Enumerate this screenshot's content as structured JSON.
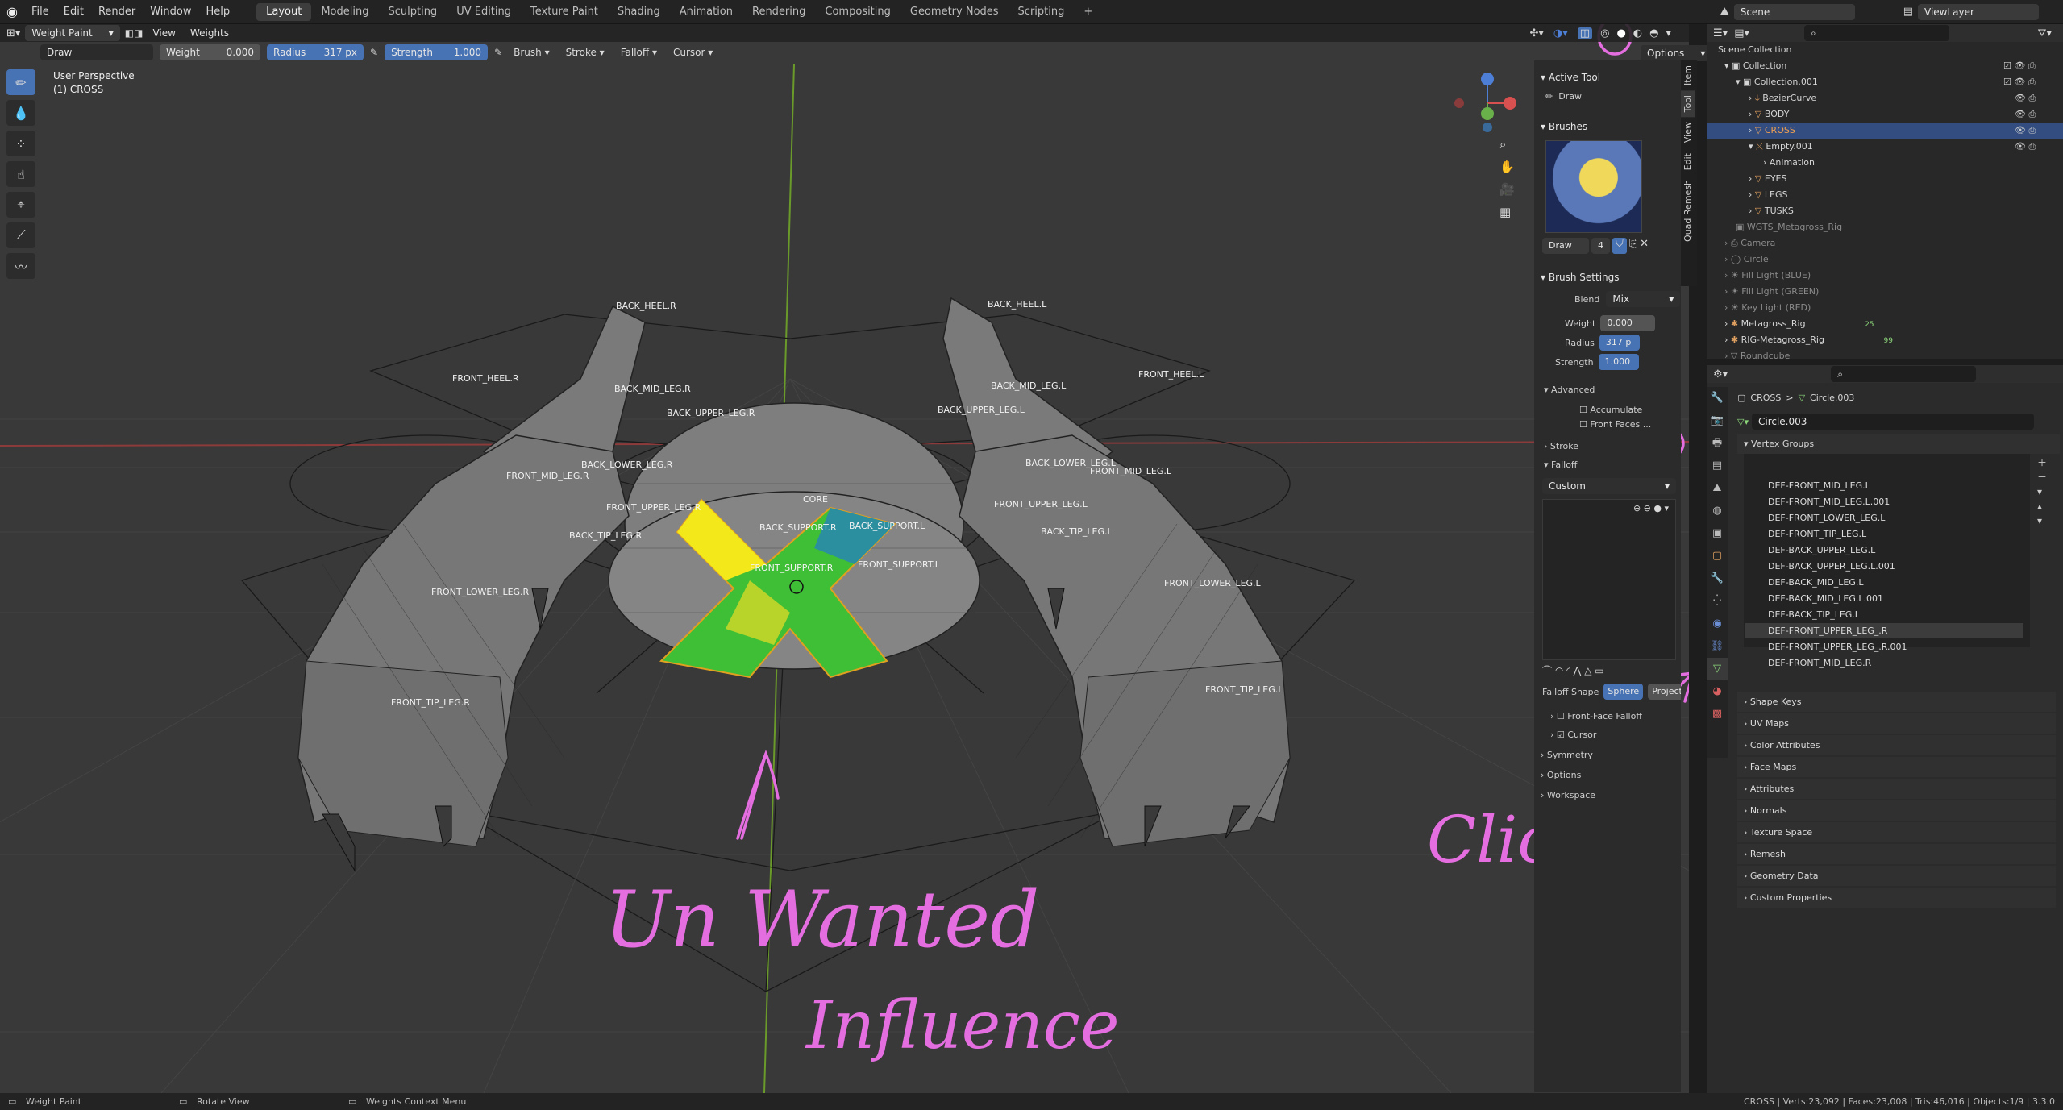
{
  "menubar": {
    "menus": [
      "File",
      "Edit",
      "Render",
      "Window",
      "Help"
    ],
    "workspaces": [
      "Layout",
      "Modeling",
      "Sculpting",
      "UV Editing",
      "Texture Paint",
      "Shading",
      "Animation",
      "Rendering",
      "Compositing",
      "Geometry Nodes",
      "Scripting"
    ],
    "active_workspace": "Layout",
    "plus": "+",
    "scene": "Scene",
    "view_layer": "ViewLayer"
  },
  "viewport": {
    "mode": "Weight Paint",
    "menus": [
      "View",
      "Weights"
    ],
    "perspective": "User Perspective",
    "object": "(1) CROSS",
    "options": "Options"
  },
  "tool_header": {
    "tool": "Draw",
    "weight_label": "Weight",
    "weight_value": "0.000",
    "radius_label": "Radius",
    "radius_value": "317 px",
    "strength_label": "Strength",
    "strength_value": "1.000",
    "dropdowns": [
      "Brush",
      "Stroke",
      "Falloff",
      "Cursor"
    ]
  },
  "bone_labels": {
    "back_heel_r": "BACK_HEEL.R",
    "back_heel_l": "BACK_HEEL.L",
    "front_heel_r": "FRONT_HEEL.R",
    "front_heel_l": "FRONT_HEEL.L",
    "back_mid_leg_r": "BACK_MID_LEG.R",
    "back_mid_leg_l": "BACK_MID_LEG.L",
    "back_upper_leg_r": "BACK_UPPER_LEG.R",
    "back_upper_leg_l": "BACK_UPPER_LEG.L",
    "back_lower_leg_r": "BACK_LOWER_LEG.R",
    "back_lower_leg_l": "BACK_LOWER_LEG.L",
    "front_mid_leg_r": "FRONT_MID_LEG.R",
    "front_mid_leg_l": "FRONT_MID_LEG.L",
    "front_upper_leg_r": "FRONT_UPPER_LEG.R",
    "front_upper_leg_l": "FRONT_UPPER_LEG.L",
    "core": "CORE",
    "back_support_r": "BACK_SUPPORT.R",
    "back_support_l": "BACK_SUPPORT.L",
    "back_tip_leg_r": "BACK_TIP_LEG.R",
    "back_tip_leg_l": "BACK_TIP_LEG.L",
    "front_support_r": "FRONT_SUPPORT.R",
    "front_support_l": "FRONT_SUPPORT.L",
    "front_lower_leg_r": "FRONT_LOWER_LEG.R",
    "front_lower_leg_l": "FRONT_LOWER_LEG.L",
    "front_tip_leg_r": "FRONT_TIP_LEG.R",
    "front_tip_leg_l": "FRONT_TIP_LEG.L"
  },
  "npanel": {
    "tabs": [
      "Item",
      "Tool",
      "View",
      "Edit",
      "Quad Remesh"
    ],
    "active_tool_header": "Active Tool",
    "active_tool": "Draw",
    "brushes_header": "Brushes",
    "brush_name": "Draw",
    "brush_users": "4",
    "brush_settings_header": "Brush Settings",
    "blend_label": "Blend",
    "blend_value": "Mix",
    "weight_label": "Weight",
    "weight_value": "0.000",
    "radius_label": "Radius",
    "radius_value": "317 p",
    "strength_label": "Strength",
    "strength_value": "1.000",
    "advanced": "Advanced",
    "accumulate": "Accumulate",
    "front_faces": "Front Faces ...",
    "stroke": "Stroke",
    "falloff": "Falloff",
    "falloff_preset": "Custom",
    "falloff_shape_label": "Falloff Shape",
    "falloff_shape_sphere": "Sphere",
    "falloff_shape_project": "Project...",
    "front_face_falloff": "Front-Face Falloff",
    "cursor": "Cursor",
    "symmetry": "Symmetry",
    "options": "Options",
    "workspace": "Workspace"
  },
  "outliner": {
    "scene_collection": "Scene Collection",
    "rows": [
      {
        "label": "Collection"
      },
      {
        "label": "Collection.001"
      },
      {
        "label": "BezierCurve"
      },
      {
        "label": "BODY"
      },
      {
        "label": "CROSS"
      },
      {
        "label": "Empty.001"
      },
      {
        "label": "Animation"
      },
      {
        "label": "EYES"
      },
      {
        "label": "LEGS"
      },
      {
        "label": "TUSKS"
      },
      {
        "label": "WGTS_Metagross_Rig"
      },
      {
        "label": "Camera"
      },
      {
        "label": "Circle"
      },
      {
        "label": "Fill Light (BLUE)"
      },
      {
        "label": "Fill Light (GREEN)"
      },
      {
        "label": "Key Light (RED)"
      },
      {
        "label": "Metagross_Rig"
      },
      {
        "label": "RIG-Metagross_Rig"
      },
      {
        "label": "Roundcube"
      }
    ],
    "count_a": "25",
    "count_b": "99"
  },
  "properties": {
    "breadcrumb_object": "CROSS",
    "breadcrumb_sep": ">",
    "breadcrumb_data": "Circle.003",
    "mesh_name": "Circle.003",
    "vertex_groups_header": "Vertex Groups",
    "vertex_groups": [
      "DEF-FRONT_MID_LEG.L",
      "DEF-FRONT_MID_LEG.L.001",
      "DEF-FRONT_LOWER_LEG.L",
      "DEF-FRONT_TIP_LEG.L",
      "DEF-BACK_UPPER_LEG.L",
      "DEF-BACK_UPPER_LEG.L.001",
      "DEF-BACK_MID_LEG.L",
      "DEF-BACK_MID_LEG.L.001",
      "DEF-BACK_TIP_LEG.L",
      "DEF-FRONT_UPPER_LEG_.R",
      "DEF-FRONT_UPPER_LEG_.R.001",
      "DEF-FRONT_MID_LEG.R"
    ],
    "panels": [
      "Shape Keys",
      "UV Maps",
      "Color Attributes",
      "Face Maps",
      "Attributes",
      "Normals",
      "Texture Space",
      "Remesh",
      "Geometry Data",
      "Custom Properties"
    ]
  },
  "annotations": {
    "click": "Click",
    "unwanted": "Un Wanted",
    "influence": "Influence"
  },
  "statusbar": {
    "left": "Weight Paint",
    "middle": "Rotate View",
    "context": "Weights Context Menu",
    "stats": "CROSS | Verts:23,092 | Faces:23,008 | Tris:46,016 | Objects:1/9 | 3.3.0"
  },
  "colors": {
    "accent": "#4772b3",
    "annotation": "#e46ee0",
    "selected_row": "#334d80",
    "weight_yellow": "#f2e81a",
    "weight_green": "#3fbf35",
    "weight_teal": "#2c8fa0"
  }
}
